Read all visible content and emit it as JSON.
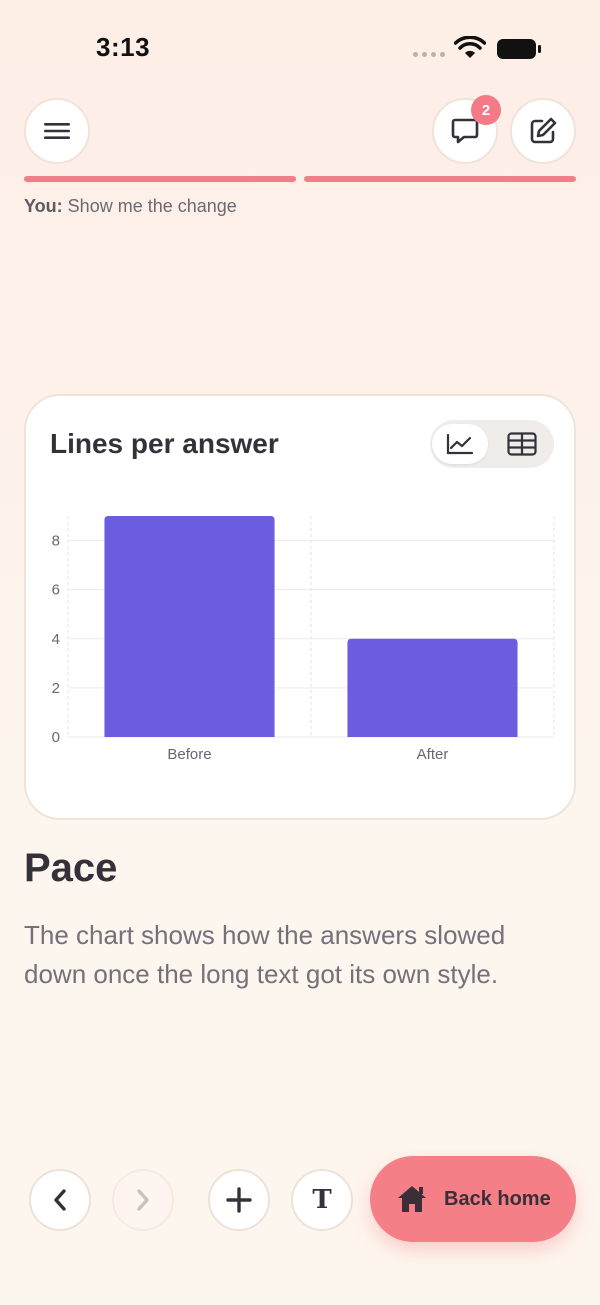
{
  "status": {
    "time": "3:13"
  },
  "header": {
    "notification_count": "2"
  },
  "transcript": {
    "speaker": "You:",
    "message": "Show me the change"
  },
  "card": {
    "title": "Lines per answer",
    "view_options": [
      "chart",
      "table"
    ],
    "selected_view": "chart"
  },
  "chart_data": {
    "type": "bar",
    "categories": [
      "Before",
      "After"
    ],
    "values": [
      9,
      4
    ],
    "ylim": [
      0,
      9
    ],
    "yticks": [
      0,
      2,
      4,
      6,
      8
    ],
    "title": "Lines per answer",
    "xlabel": "",
    "ylabel": "",
    "grid": true,
    "colors": {
      "bar": "#6b5ce0"
    }
  },
  "content": {
    "heading": "Pace",
    "body": "The chart shows how the answers slowed down once the long text got its own style."
  },
  "footer": {
    "text_button_glyph": "T",
    "home_button_label": "Back home"
  },
  "colors": {
    "accent": "#f57f87",
    "bar": "#6b5ce0"
  }
}
